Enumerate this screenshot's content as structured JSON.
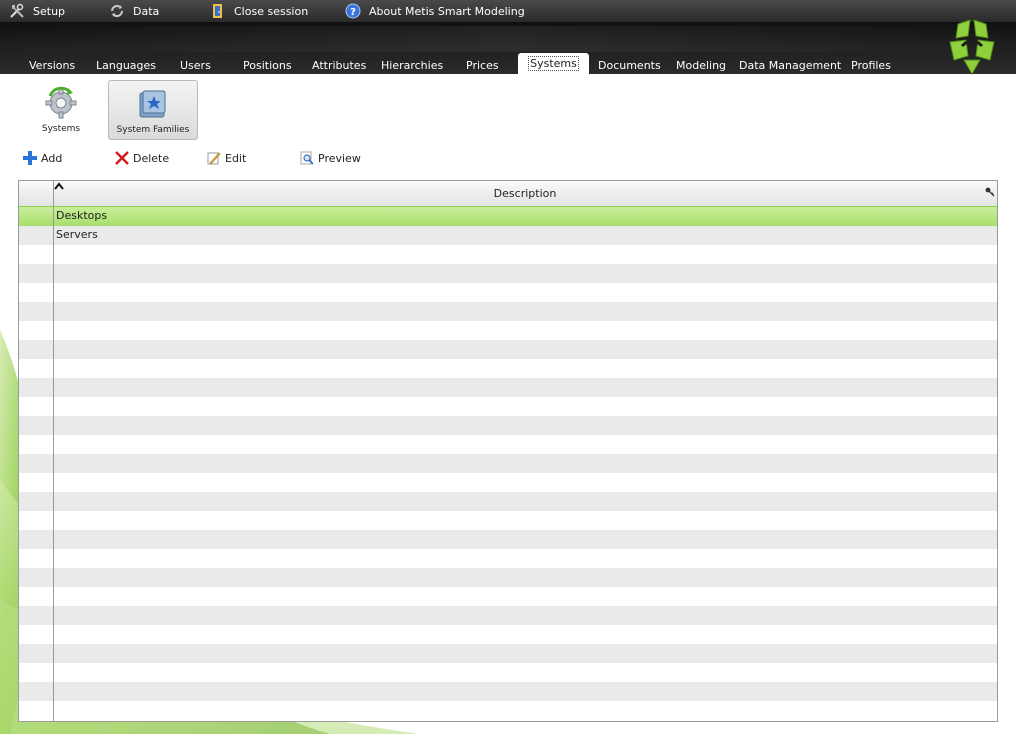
{
  "menu": {
    "setup": "Setup",
    "data": "Data",
    "close_session": "Close session",
    "about": "About Metis Smart Modeling"
  },
  "tabs": [
    {
      "label": "Versions",
      "active": false
    },
    {
      "label": "Languages",
      "active": false
    },
    {
      "label": "Users",
      "active": false
    },
    {
      "label": "Positions",
      "active": false
    },
    {
      "label": "Attributes",
      "active": false
    },
    {
      "label": "Hierarchies",
      "active": false
    },
    {
      "label": "Prices",
      "active": false
    },
    {
      "label": "Systems",
      "active": true
    },
    {
      "label": "Documents",
      "active": false
    },
    {
      "label": "Modeling",
      "active": false
    },
    {
      "label": "Data Management",
      "active": false
    },
    {
      "label": "Profiles",
      "active": false
    }
  ],
  "subtabs": {
    "systems": "Systems",
    "system_families": "System Families"
  },
  "toolbar": {
    "add": "Add",
    "delete": "Delete",
    "edit": "Edit",
    "preview": "Preview"
  },
  "grid": {
    "column": "Description",
    "rows": [
      "Desktops",
      "Servers"
    ],
    "selected_index": 0
  },
  "colors": {
    "accent_green": "#8ccf3e",
    "header_dark": "#1d1d1d"
  }
}
